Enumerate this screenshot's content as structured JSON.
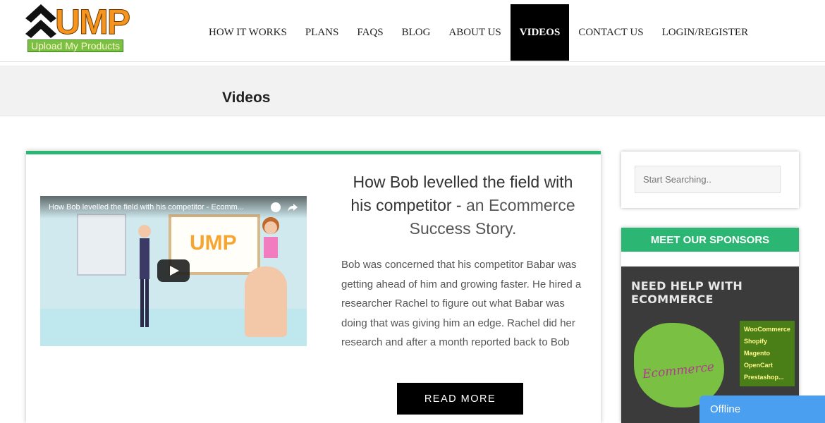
{
  "logo": {
    "name": "UMP",
    "tagline": "Upload My Products"
  },
  "nav": [
    {
      "label": "HOW IT WORKS"
    },
    {
      "label": "PLANS"
    },
    {
      "label": "FAQS"
    },
    {
      "label": "BLOG"
    },
    {
      "label": "ABOUT US"
    },
    {
      "label": "VIDEOS",
      "active": true
    },
    {
      "label": "CONTACT US"
    },
    {
      "label": "LOGIN/REGISTER"
    }
  ],
  "page": {
    "title": "Videos"
  },
  "post": {
    "video_title": "How Bob levelled the field with his competitor - Ecomm...",
    "video_board_text": "UMP",
    "title_main": "How Bob levelled the field with his competitor -",
    "title_accent": "an Ecommerce Success Story.",
    "body": "Bob was concerned that his competitor Babar was getting ahead of him and growing faster. He hired a researcher Rachel to figure out what Babar was doing that was giving him an edge. Rachel did her research and after a month reported back to Bob",
    "read_more": "READ MORE"
  },
  "sidebar": {
    "search_placeholder": "Start Searching..",
    "sponsor_heading": "MEET OUR SPONSORS",
    "ad": {
      "headline": "NEED HELP WITH ECOMMERCE",
      "script_text": "Ecommerce",
      "platforms": [
        "WooCommerce",
        "Shopify",
        "Magento",
        "OpenCart",
        "Prestashop..."
      ]
    }
  },
  "chat": {
    "status": "Offline"
  },
  "colors": {
    "accent_green": "#2bb673",
    "nav_active_bg": "#000000",
    "chat_blue": "#4a9ff0",
    "logo_orange": "#f7941d"
  }
}
